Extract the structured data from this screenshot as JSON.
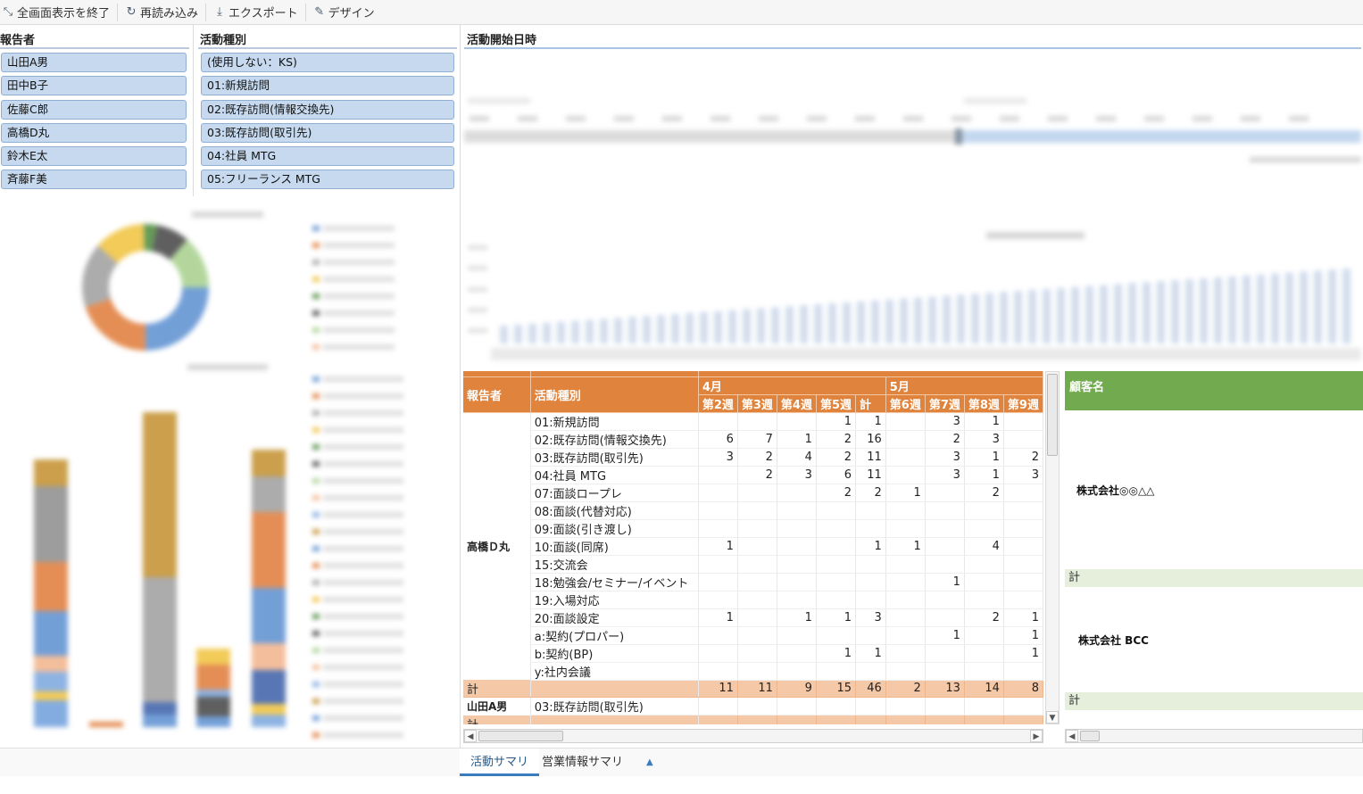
{
  "toolbar": {
    "exit_fullscreen": "全画面表示を終了",
    "reload": "再読み込み",
    "export": "エクスポート",
    "design": "デザイン"
  },
  "reporter_filter": {
    "title": "報告者",
    "items": [
      "山田A男",
      "田中B子",
      "佐藤C郎",
      "高橋D丸",
      "鈴木E太",
      "斉藤F美"
    ]
  },
  "activity_filter": {
    "title": "活動種別",
    "items": [
      "(使用しない：KS)",
      "01:新規訪問",
      "02:既存訪問(情報交換先)",
      "03:既存訪問(取引先)",
      "04:社員 MTG",
      "05:フリーランス MTG"
    ]
  },
  "timeline": {
    "title": "活動開始日時"
  },
  "pivot": {
    "col_reporter": "報告者",
    "col_activity": "活動種別",
    "months": [
      {
        "label": "4月",
        "weeks": [
          "第2週",
          "第3週",
          "第4週",
          "第5週",
          "計"
        ]
      },
      {
        "label": "5月",
        "weeks": [
          "第6週",
          "第7週",
          "第8週",
          "第9週"
        ]
      }
    ],
    "group1": {
      "reporter": "高橋Ｄ丸",
      "rows": [
        {
          "activity": "01:新規訪問",
          "values": [
            "",
            "",
            "",
            "1",
            "1",
            "",
            "3",
            "1",
            ""
          ]
        },
        {
          "activity": "02:既存訪問(情報交換先)",
          "values": [
            "6",
            "7",
            "1",
            "2",
            "16",
            "",
            "2",
            "3",
            ""
          ]
        },
        {
          "activity": "03:既存訪問(取引先)",
          "values": [
            "3",
            "2",
            "4",
            "2",
            "11",
            "",
            "3",
            "1",
            "2"
          ]
        },
        {
          "activity": "04:社員 MTG",
          "values": [
            "",
            "2",
            "3",
            "6",
            "11",
            "",
            "3",
            "1",
            "3"
          ]
        },
        {
          "activity": "07:面談ロープレ",
          "values": [
            "",
            "",
            "",
            "2",
            "2",
            "1",
            "",
            "2",
            ""
          ]
        },
        {
          "activity": "08:面談(代替対応)",
          "values": [
            "",
            "",
            "",
            "",
            "",
            "",
            "",
            "",
            ""
          ]
        },
        {
          "activity": "09:面談(引き渡し)",
          "values": [
            "",
            "",
            "",
            "",
            "",
            "",
            "",
            "",
            ""
          ]
        },
        {
          "activity": "10:面談(同席)",
          "values": [
            "1",
            "",
            "",
            "",
            "1",
            "1",
            "",
            "4",
            ""
          ]
        },
        {
          "activity": "15:交流会",
          "values": [
            "",
            "",
            "",
            "",
            "",
            "",
            "",
            "",
            ""
          ]
        },
        {
          "activity": "18:勉強会/セミナー/イベント",
          "values": [
            "",
            "",
            "",
            "",
            "",
            "",
            "1",
            "",
            ""
          ]
        },
        {
          "activity": "19:入場対応",
          "values": [
            "",
            "",
            "",
            "",
            "",
            "",
            "",
            "",
            ""
          ]
        },
        {
          "activity": "20:面談設定",
          "values": [
            "1",
            "",
            "1",
            "1",
            "3",
            "",
            "",
            "2",
            "1"
          ]
        },
        {
          "activity": "a:契約(プロパー)",
          "values": [
            "",
            "",
            "",
            "",
            "",
            "",
            "1",
            "",
            "1"
          ]
        },
        {
          "activity": "b:契約(BP)",
          "values": [
            "",
            "",
            "",
            "1",
            "1",
            "",
            "",
            "",
            "1"
          ]
        },
        {
          "activity": "y:社内会議",
          "values": [
            "",
            "",
            "",
            "",
            "",
            "",
            "",
            "",
            ""
          ]
        }
      ],
      "total_label": "計",
      "totals": [
        "11",
        "11",
        "9",
        "15",
        "46",
        "2",
        "13",
        "14",
        "8"
      ]
    },
    "group2": {
      "reporter": "山田A男",
      "rows": [
        {
          "activity": "03:既存訪問(取引先)",
          "values": [
            "",
            "",
            "",
            "",
            "",
            "",
            "",
            "",
            ""
          ]
        }
      ],
      "total_label": "計"
    }
  },
  "customer_pane": {
    "header": "顧客名",
    "entries": [
      {
        "name": "株式会社◎◎△△",
        "total_label": "計"
      },
      {
        "name": "株式会社 BCC",
        "total_label": "計"
      }
    ]
  },
  "tabs": [
    {
      "label": "活動サマリ",
      "active": true
    },
    {
      "label": "営業情報サマリ",
      "active": false
    }
  ],
  "colors": {
    "pivot_header": "#e0833d",
    "pivot_total": "#f5c8a8",
    "customer_header": "#72ab4f",
    "filter_item": "#c6d9ee"
  }
}
